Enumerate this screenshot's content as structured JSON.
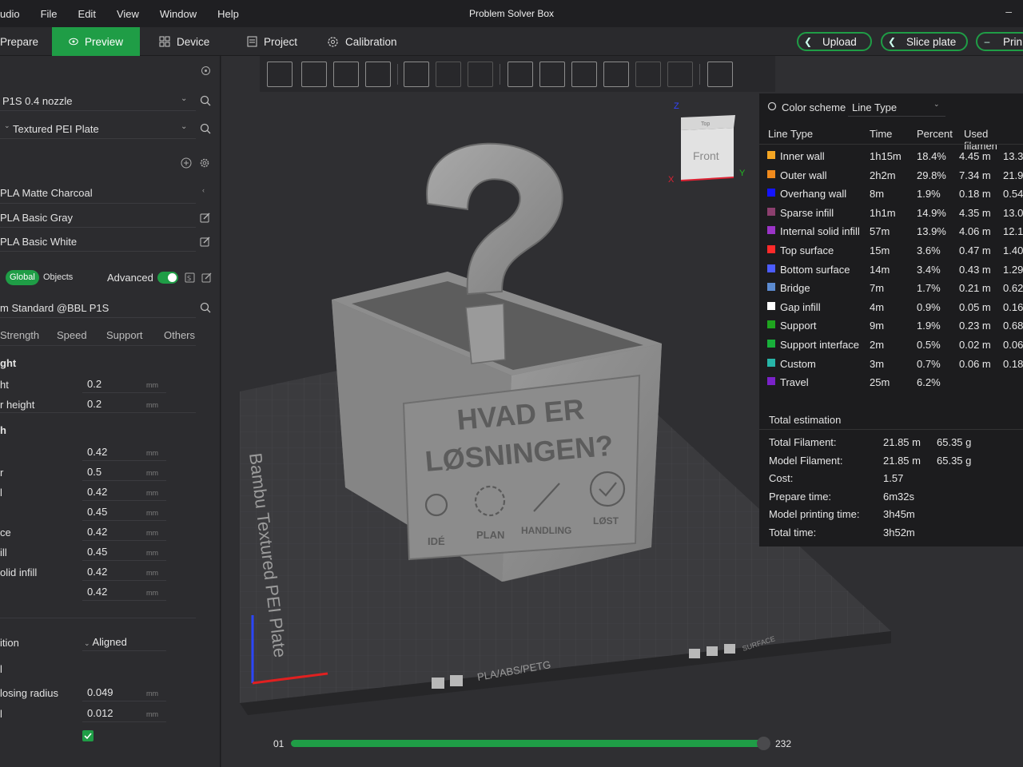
{
  "menu": {
    "items": [
      "udio",
      "File",
      "Edit",
      "View",
      "Window",
      "Help"
    ],
    "title": "Problem Solver Box",
    "minimize": "–"
  },
  "toolbar": {
    "tabs": [
      "Prepare",
      "Preview",
      "Device",
      "Project",
      "Calibration"
    ],
    "upload_label": "Upload",
    "slice_label": "Slice plate",
    "print_label": "Prin"
  },
  "sidebar": {
    "printer": "P1S 0.4 nozzle",
    "plate": "Textured PEI Plate",
    "filaments": [
      "PLA Matte Charcoal",
      "PLA Basic Gray",
      "PLA Basic White"
    ],
    "toggle": {
      "global": "Global",
      "objects": "Objects",
      "advanced": "Advanced"
    },
    "process": "m Standard @BBL P1S",
    "process_tabs": [
      "Strength",
      "Speed",
      "Support",
      "Others"
    ],
    "section_layer": "ght",
    "layer_rows": [
      {
        "label": "ht",
        "value": "0.2",
        "unit": "mm"
      },
      {
        "label": "r height",
        "value": "0.2",
        "unit": "mm"
      }
    ],
    "section_width": "h",
    "width_rows": [
      {
        "label": "",
        "value": "0.42",
        "unit": "mm"
      },
      {
        "label": "r",
        "value": "0.5",
        "unit": "mm"
      },
      {
        "label": "l",
        "value": "0.42",
        "unit": "mm"
      },
      {
        "label": "",
        "value": "0.45",
        "unit": "mm"
      },
      {
        "label": "ce",
        "value": "0.42",
        "unit": "mm"
      },
      {
        "label": "ill",
        "value": "0.45",
        "unit": "mm"
      },
      {
        "label": "olid infill",
        "value": "0.42",
        "unit": "mm"
      },
      {
        "label": "",
        "value": "0.42",
        "unit": "mm"
      }
    ],
    "seam_label": "ition",
    "seam_value": "Aligned",
    "closing_label": "losing radius",
    "closing_value": "0.049",
    "closing_unit": "mm",
    "res_label": "l",
    "res_value": "0.012",
    "res_unit": "mm"
  },
  "viewport": {
    "cube_top": "Top",
    "cube_front": "Front",
    "plate_text": "Bambu Textured PEI Plate",
    "plate_material": "PLA/ABS/PETG",
    "plate_surface": "SURFACE",
    "box_line1": "HVAD ER",
    "box_line2": "LØSNINGEN?",
    "box_icons": [
      "IDÉ",
      "PLAN",
      "HANDLING",
      "LØST"
    ],
    "axes": {
      "x": "X",
      "y": "Y",
      "z": "Z"
    }
  },
  "legend": {
    "color_scheme_label": "Color scheme",
    "color_scheme_value": "Line Type",
    "headers": [
      "Line Type",
      "Time",
      "Percent",
      "Used filamen"
    ],
    "rows": [
      {
        "name": "Inner wall",
        "color": "#f5a623",
        "time": "1h15m",
        "percent": "18.4%",
        "used_m": "4.45 m",
        "used_g": "13.3"
      },
      {
        "name": "Outer wall",
        "color": "#f08a1c",
        "time": "2h2m",
        "percent": "29.8%",
        "used_m": "7.34 m",
        "used_g": "21.9"
      },
      {
        "name": "Overhang wall",
        "color": "#1414ff",
        "time": "8m",
        "percent": "1.9%",
        "used_m": "0.18 m",
        "used_g": "0.54"
      },
      {
        "name": "Sparse infill",
        "color": "#8c3f6e",
        "time": "1h1m",
        "percent": "14.9%",
        "used_m": "4.35 m",
        "used_g": "13.0"
      },
      {
        "name": "Internal solid infill",
        "color": "#9b34c7",
        "time": "57m",
        "percent": "13.9%",
        "used_m": "4.06 m",
        "used_g": "12.1"
      },
      {
        "name": "Top surface",
        "color": "#ff2a2a",
        "time": "15m",
        "percent": "3.6%",
        "used_m": "0.47 m",
        "used_g": "1.40"
      },
      {
        "name": "Bottom surface",
        "color": "#4b5cff",
        "time": "14m",
        "percent": "3.4%",
        "used_m": "0.43 m",
        "used_g": "1.29"
      },
      {
        "name": "Bridge",
        "color": "#5c8bd1",
        "time": "7m",
        "percent": "1.7%",
        "used_m": "0.21 m",
        "used_g": "0.62"
      },
      {
        "name": "Gap infill",
        "color": "#ffffff",
        "time": "4m",
        "percent": "0.9%",
        "used_m": "0.05 m",
        "used_g": "0.16"
      },
      {
        "name": "Support",
        "color": "#1fa51f",
        "time": "9m",
        "percent": "1.9%",
        "used_m": "0.23 m",
        "used_g": "0.68"
      },
      {
        "name": "Support interface",
        "color": "#18b03a",
        "time": "2m",
        "percent": "0.5%",
        "used_m": "0.02 m",
        "used_g": "0.06"
      },
      {
        "name": "Custom",
        "color": "#27b5a8",
        "time": "3m",
        "percent": "0.7%",
        "used_m": "0.06 m",
        "used_g": "0.18"
      },
      {
        "name": "Travel",
        "color": "#7a22c9",
        "time": "25m",
        "percent": "6.2%",
        "used_m": "",
        "used_g": ""
      }
    ],
    "estimation_title": "Total estimation",
    "estimation": [
      {
        "label": "Total Filament:",
        "value": "21.85 m",
        "value2": "65.35 g"
      },
      {
        "label": "Model Filament:",
        "value": "21.85 m",
        "value2": "65.35 g"
      },
      {
        "label": "Cost:",
        "value": "1.57",
        "value2": ""
      },
      {
        "label": "Prepare time:",
        "value": "6m32s",
        "value2": ""
      },
      {
        "label": "Model printing time:",
        "value": "3h45m",
        "value2": ""
      },
      {
        "label": "Total time:",
        "value": "3h52m",
        "value2": ""
      }
    ]
  },
  "layer_slider": {
    "min_label": "01",
    "max_label": "232"
  },
  "colors": {
    "accent": "#1f9d46"
  }
}
